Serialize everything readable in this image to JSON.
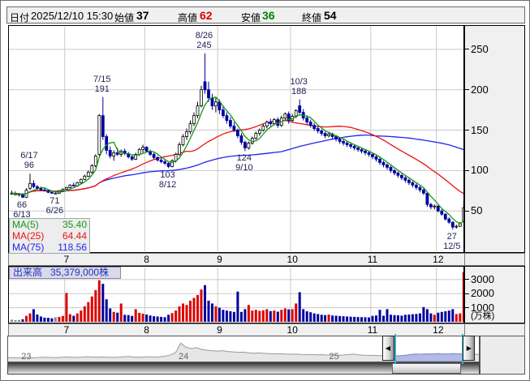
{
  "header": {
    "date_label": "日付",
    "date_value": "2025/12/10 15:30",
    "open_label": "始値",
    "open_value": "37",
    "high_label": "高値",
    "high_value": "62",
    "low_label": "安値",
    "low_value": "36",
    "close_label": "終値",
    "close_value": "54"
  },
  "colors": {
    "up_volume": "#dd0000",
    "down_volume": "#0000a0",
    "flat_volume": "#888888",
    "candle_up_fill": "#ffffff",
    "candle_down_fill": "#0000a0",
    "ma5": "#169616",
    "ma25": "#ee1111",
    "ma75": "#2222ee",
    "grid": "#c9c9c9",
    "annotation_text": "#222255",
    "high_value_text": "#dd0000",
    "low_value_text": "#008000",
    "selection_fill": "#b2bae6",
    "selection_line": "#7f88c4",
    "nav_line": "#9a9a9a",
    "nav_fill": "#e6e6e6"
  },
  "ma_legend": [
    {
      "label": "MA(5)",
      "value": "35.40",
      "color": "#169616"
    },
    {
      "label": "MA(25)",
      "value": "64.44",
      "color": "#ee1111"
    },
    {
      "label": "MA(75)",
      "value": "118.56",
      "color": "#2222ee"
    }
  ],
  "volume_header": {
    "label": "出来高",
    "value": "35,379,000株"
  },
  "chart_data": {
    "type": "candlestick+volume",
    "candle_format": "[date, open, high, low, close, volume_in_10k_shares]",
    "price_axis": {
      "ticks": [
        50,
        100,
        150,
        200,
        250
      ],
      "range": [
        0,
        278
      ]
    },
    "volume_axis": {
      "ticks": [
        1000,
        2000,
        3000
      ],
      "unit": "(万株)",
      "range": [
        0,
        3800
      ]
    },
    "month_labels": [
      "7",
      "8",
      "9",
      "10",
      "11",
      "12"
    ],
    "annotations": [
      {
        "date": "6/17",
        "price": 96,
        "side": "high"
      },
      {
        "date": "6/13",
        "price": 66,
        "side": "low"
      },
      {
        "date": "6/26",
        "price": 71,
        "side": "low"
      },
      {
        "date": "7/15",
        "price": 191,
        "side": "high"
      },
      {
        "date": "8/12",
        "price": 103,
        "side": "low"
      },
      {
        "date": "8/26",
        "price": 245,
        "side": "high"
      },
      {
        "date": "9/10",
        "price": 124,
        "side": "low"
      },
      {
        "date": "10/3",
        "price": 188,
        "side": "high"
      },
      {
        "date": "12/5",
        "price": 27,
        "side": "low"
      }
    ],
    "candles": [
      [
        "6/10",
        72,
        75,
        70,
        72,
        150
      ],
      [
        "6/11",
        71,
        74,
        70,
        71,
        120
      ],
      [
        "6/12",
        71,
        72,
        68,
        71,
        130
      ],
      [
        "6/13",
        71,
        72,
        66,
        67,
        180
      ],
      [
        "6/16",
        67,
        78,
        66,
        76,
        420
      ],
      [
        "6/17",
        78,
        96,
        76,
        84,
        600
      ],
      [
        "6/18",
        84,
        88,
        78,
        80,
        900
      ],
      [
        "6/19",
        80,
        82,
        76,
        78,
        520
      ],
      [
        "6/20",
        78,
        80,
        75,
        76,
        380
      ],
      [
        "6/23",
        76,
        78,
        74,
        75,
        300
      ],
      [
        "6/24",
        75,
        76,
        72,
        73,
        280
      ],
      [
        "6/25",
        73,
        75,
        71,
        72,
        250
      ],
      [
        "6/26",
        72,
        73,
        71,
        72,
        320
      ],
      [
        "6/27",
        72,
        76,
        71,
        75,
        350
      ],
      [
        "6/30",
        75,
        78,
        74,
        77,
        420
      ],
      [
        "7/1",
        77,
        80,
        76,
        79,
        2050
      ],
      [
        "7/2",
        79,
        83,
        78,
        82,
        540
      ],
      [
        "7/3",
        82,
        85,
        80,
        81,
        430
      ],
      [
        "7/4",
        81,
        86,
        80,
        85,
        600
      ],
      [
        "7/7",
        85,
        90,
        84,
        89,
        800
      ],
      [
        "7/8",
        89,
        95,
        88,
        93,
        1100
      ],
      [
        "7/9",
        93,
        100,
        92,
        98,
        1400
      ],
      [
        "7/10",
        98,
        108,
        96,
        106,
        1800
      ],
      [
        "7/11",
        106,
        120,
        104,
        118,
        2250
      ],
      [
        "7/14",
        120,
        170,
        118,
        168,
        2950
      ],
      [
        "7/15",
        168,
        191,
        138,
        142,
        2700
      ],
      [
        "7/16",
        142,
        145,
        120,
        125,
        1600
      ],
      [
        "7/17",
        125,
        130,
        115,
        118,
        950
      ],
      [
        "7/18",
        118,
        125,
        112,
        122,
        700
      ],
      [
        "7/22",
        122,
        128,
        118,
        120,
        650
      ],
      [
        "7/23",
        120,
        126,
        117,
        124,
        1300
      ],
      [
        "7/24",
        124,
        127,
        119,
        121,
        500
      ],
      [
        "7/25",
        121,
        123,
        115,
        117,
        480
      ],
      [
        "7/28",
        117,
        120,
        112,
        114,
        420
      ],
      [
        "7/29",
        114,
        122,
        113,
        120,
        900
      ],
      [
        "7/30",
        120,
        128,
        118,
        126,
        640
      ],
      [
        "7/31",
        126,
        132,
        122,
        129,
        580
      ],
      [
        "8/1",
        129,
        130,
        122,
        124,
        520
      ],
      [
        "8/4",
        124,
        126,
        118,
        120,
        450
      ],
      [
        "8/5",
        120,
        122,
        114,
        116,
        400
      ],
      [
        "8/6",
        116,
        118,
        111,
        113,
        380
      ],
      [
        "8/7",
        113,
        116,
        109,
        111,
        350
      ],
      [
        "8/8",
        111,
        113,
        107,
        109,
        330
      ],
      [
        "8/12",
        109,
        110,
        103,
        105,
        500
      ],
      [
        "8/13",
        105,
        114,
        104,
        112,
        620
      ],
      [
        "8/14",
        112,
        122,
        110,
        120,
        800
      ],
      [
        "8/15",
        120,
        135,
        118,
        132,
        1100
      ],
      [
        "8/18",
        132,
        145,
        130,
        142,
        1300
      ],
      [
        "8/19",
        142,
        152,
        138,
        148,
        1200
      ],
      [
        "8/20",
        148,
        162,
        145,
        158,
        1500
      ],
      [
        "8/21",
        158,
        172,
        155,
        168,
        1700
      ],
      [
        "8/22",
        168,
        185,
        165,
        180,
        1900
      ],
      [
        "8/25",
        180,
        205,
        178,
        200,
        2300
      ],
      [
        "8/26",
        210,
        245,
        195,
        200,
        2600
      ],
      [
        "8/27",
        200,
        210,
        185,
        190,
        1500
      ],
      [
        "8/28",
        190,
        195,
        175,
        180,
        1300
      ],
      [
        "8/29",
        180,
        190,
        172,
        185,
        1100
      ],
      [
        "9/1",
        185,
        188,
        170,
        175,
        1000
      ],
      [
        "9/2",
        175,
        180,
        165,
        168,
        850
      ],
      [
        "9/3",
        168,
        172,
        158,
        162,
        800
      ],
      [
        "9/4",
        162,
        166,
        152,
        155,
        750
      ],
      [
        "9/5",
        155,
        160,
        148,
        150,
        700
      ],
      [
        "9/8",
        150,
        152,
        140,
        143,
        2150
      ],
      [
        "9/9",
        143,
        146,
        132,
        135,
        700
      ],
      [
        "9/10",
        135,
        137,
        124,
        128,
        900
      ],
      [
        "9/11",
        128,
        136,
        126,
        134,
        1200
      ],
      [
        "9/12",
        134,
        142,
        132,
        140,
        800
      ],
      [
        "9/16",
        140,
        148,
        138,
        146,
        850
      ],
      [
        "9/17",
        146,
        152,
        143,
        150,
        780
      ],
      [
        "9/18",
        150,
        158,
        148,
        155,
        820
      ],
      [
        "9/19",
        155,
        162,
        152,
        160,
        900
      ],
      [
        "9/22",
        160,
        164,
        155,
        158,
        760
      ],
      [
        "9/24",
        158,
        165,
        156,
        163,
        800
      ],
      [
        "9/25",
        163,
        166,
        153,
        156,
        720
      ],
      [
        "9/26",
        156,
        168,
        154,
        165,
        850
      ],
      [
        "9/29",
        165,
        172,
        162,
        170,
        950
      ],
      [
        "9/30",
        170,
        173,
        158,
        162,
        880
      ],
      [
        "10/1",
        162,
        170,
        160,
        167,
        900
      ],
      [
        "10/2",
        167,
        176,
        165,
        174,
        1300
      ],
      [
        "10/3",
        180,
        188,
        170,
        172,
        2100
      ],
      [
        "10/6",
        172,
        176,
        162,
        165,
        900
      ],
      [
        "10/7",
        165,
        168,
        157,
        160,
        750
      ],
      [
        "10/8",
        160,
        163,
        153,
        156,
        680
      ],
      [
        "10/9",
        156,
        159,
        149,
        152,
        600
      ],
      [
        "10/10",
        152,
        155,
        146,
        149,
        550
      ],
      [
        "10/14",
        149,
        151,
        143,
        146,
        500
      ],
      [
        "10/15",
        146,
        148,
        140,
        143,
        480
      ],
      [
        "10/16",
        143,
        148,
        141,
        145,
        520
      ],
      [
        "10/17",
        145,
        147,
        139,
        142,
        450
      ],
      [
        "10/20",
        142,
        144,
        136,
        139,
        430
      ],
      [
        "10/21",
        139,
        141,
        133,
        136,
        410
      ],
      [
        "10/22",
        136,
        139,
        131,
        134,
        400
      ],
      [
        "10/23",
        134,
        136,
        129,
        132,
        380
      ],
      [
        "10/24",
        132,
        134,
        127,
        130,
        360
      ],
      [
        "10/27",
        130,
        132,
        125,
        128,
        350
      ],
      [
        "10/28",
        128,
        130,
        123,
        126,
        340
      ],
      [
        "10/29",
        126,
        128,
        121,
        124,
        330
      ],
      [
        "10/30",
        124,
        126,
        119,
        122,
        320
      ],
      [
        "10/31",
        122,
        124,
        117,
        120,
        310
      ],
      [
        "11/4",
        120,
        121,
        114,
        117,
        420
      ],
      [
        "11/5",
        117,
        119,
        111,
        114,
        450
      ],
      [
        "11/6",
        114,
        116,
        107,
        110,
        850
      ],
      [
        "11/7",
        110,
        112,
        104,
        107,
        430
      ],
      [
        "11/10",
        107,
        109,
        101,
        104,
        900
      ],
      [
        "11/11",
        104,
        106,
        97,
        100,
        500
      ],
      [
        "11/12",
        100,
        102,
        94,
        97,
        480
      ],
      [
        "11/13",
        97,
        99,
        91,
        94,
        460
      ],
      [
        "11/14",
        94,
        96,
        88,
        91,
        440
      ],
      [
        "11/17",
        91,
        93,
        85,
        88,
        500
      ],
      [
        "11/18",
        88,
        90,
        82,
        85,
        520
      ],
      [
        "11/19",
        85,
        87,
        79,
        82,
        540
      ],
      [
        "11/20",
        82,
        84,
        76,
        79,
        560
      ],
      [
        "11/21",
        79,
        81,
        73,
        76,
        600
      ],
      [
        "11/25",
        76,
        78,
        70,
        72,
        1050
      ],
      [
        "11/26",
        72,
        73,
        55,
        58,
        900
      ],
      [
        "11/27",
        58,
        60,
        52,
        55,
        600
      ],
      [
        "11/28",
        55,
        58,
        52,
        56,
        500
      ],
      [
        "12/1",
        56,
        57,
        48,
        50,
        650
      ],
      [
        "12/2",
        50,
        52,
        44,
        46,
        700
      ],
      [
        "12/3",
        46,
        47,
        38,
        40,
        750
      ],
      [
        "12/4",
        40,
        42,
        34,
        36,
        800
      ],
      [
        "12/5",
        36,
        37,
        27,
        30,
        900
      ],
      [
        "12/8",
        30,
        33,
        28,
        31,
        550
      ],
      [
        "12/9",
        31,
        36,
        30,
        34,
        600
      ],
      [
        "12/10",
        37,
        62,
        36,
        54,
        3538
      ]
    ]
  },
  "navigator": {
    "year_labels": [
      {
        "text": "23",
        "xf": 0.028
      },
      {
        "text": "24",
        "xf": 0.362
      },
      {
        "text": "25",
        "xf": 0.682
      }
    ],
    "selection": {
      "start_frac": 0.825,
      "end_frac": 0.966
    },
    "points": [
      0.1,
      0.11,
      0.1,
      0.12,
      0.11,
      0.1,
      0.12,
      0.13,
      0.12,
      0.11,
      0.12,
      0.14,
      0.13,
      0.12,
      0.13,
      0.15,
      0.14,
      0.13,
      0.14,
      0.13,
      0.12,
      0.13,
      0.15,
      0.16,
      0.14,
      0.13,
      0.14,
      0.15,
      0.14,
      0.15,
      0.18,
      0.24,
      0.34,
      0.8,
      0.6,
      0.54,
      0.58,
      0.5,
      0.46,
      0.44,
      0.42,
      0.44,
      0.4,
      0.38,
      0.36,
      0.37,
      0.34,
      0.32,
      0.33,
      0.31,
      0.3,
      0.29,
      0.3,
      0.28,
      0.27,
      0.28,
      0.26,
      0.25,
      0.26,
      0.24,
      0.25,
      0.23,
      0.24,
      0.22,
      0.23,
      0.25,
      0.28,
      0.24,
      0.22,
      0.21,
      0.22,
      0.2,
      0.21,
      0.2,
      0.19,
      0.2,
      0.22,
      0.26,
      0.28,
      0.27,
      0.29,
      0.28,
      0.3,
      0.29,
      0.28,
      0.3,
      0.29,
      0.27,
      0.26,
      0.28,
      0.25
    ]
  }
}
